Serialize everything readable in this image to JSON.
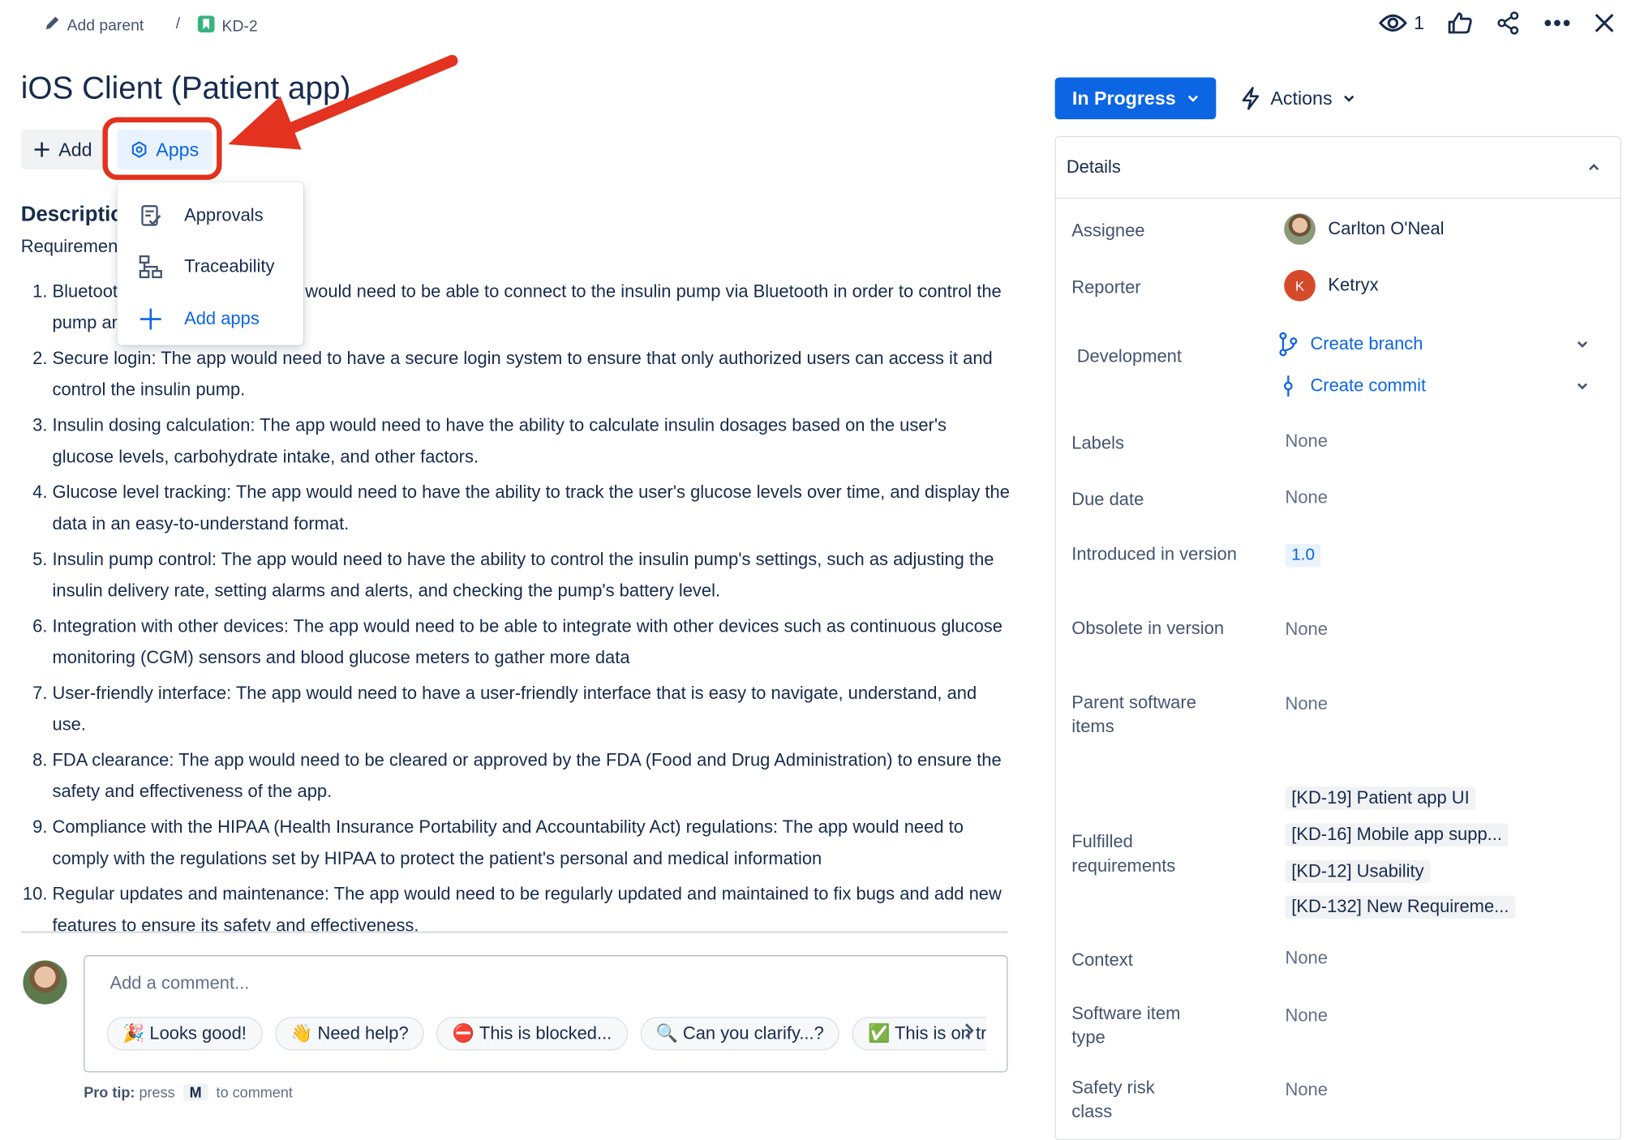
{
  "breadcrumb": {
    "add_parent": "Add parent",
    "separator": "/",
    "issue_key": "KD-2"
  },
  "top_actions": {
    "watch_count": "1"
  },
  "issue": {
    "title": "iOS Client (Patient app)"
  },
  "toolbar": {
    "add_label": "Add",
    "apps_label": "Apps"
  },
  "apps_menu": {
    "items": [
      {
        "label": "Approvals"
      },
      {
        "label": "Traceability"
      },
      {
        "label": "Add apps"
      }
    ]
  },
  "description": {
    "heading": "Description",
    "intro": "Requirements",
    "items": [
      "Bluetooth connectivity: The app would need to be able to connect to the insulin pump via Bluetooth in order to control the pump and retrieve data from it.",
      "Secure login: The app would need to have a secure login system to ensure that only authorized users can access it and control the insulin pump.",
      "Insulin dosing calculation: The app would need to have the ability to calculate insulin dosages based on the user's glucose levels, carbohydrate intake, and other factors.",
      "Glucose level tracking: The app would need to have the ability to track the user's glucose levels over time, and display the data in an easy-to-understand format.",
      "Insulin pump control: The app would need to have the ability to control the insulin pump's settings, such as adjusting the insulin delivery rate, setting alarms and alerts, and checking the pump's battery level.",
      "Integration with other devices: The app would need to be able to integrate with other devices such as continuous glucose monitoring (CGM) sensors and blood glucose meters to gather more data",
      "User-friendly interface: The app would need to have a user-friendly interface that is easy to navigate, understand, and use.",
      "FDA clearance: The app would need to be cleared or approved by the FDA (Food and Drug Administration) to ensure the safety and effectiveness of the app.",
      "Compliance with the HIPAA (Health Insurance Portability and Accountability Act) regulations: The app would need to comply with the regulations set by HIPAA to protect the patient's personal and medical information",
      "Regular updates and maintenance: The app would need to be regularly updated and maintained to fix bugs and add new features to ensure its safety and effectiveness."
    ]
  },
  "comment": {
    "placeholder": "Add a comment...",
    "chips": [
      "🎉 Looks good!",
      "👋 Need help?",
      "⛔ This is blocked...",
      "🔍 Can you clarify...?",
      "✅ This is on track"
    ],
    "pro_tip_label": "Pro tip:",
    "pro_tip_press": "press",
    "pro_tip_key": "M",
    "pro_tip_rest": "to comment"
  },
  "status": {
    "label": "In Progress",
    "actions_label": "Actions",
    "color": "#0c66e4"
  },
  "details": {
    "heading": "Details",
    "assignee": {
      "label": "Assignee",
      "value": "Carlton O'Neal"
    },
    "reporter": {
      "label": "Reporter",
      "value": "Ketryx",
      "initial": "K"
    },
    "development": {
      "label": "Development",
      "create_branch": "Create branch",
      "create_commit": "Create commit"
    },
    "labels": {
      "label": "Labels",
      "value": "None"
    },
    "due_date": {
      "label": "Due date",
      "value": "None"
    },
    "introduced_in_version": {
      "label": "Introduced in version",
      "value": "1.0"
    },
    "obsolete_in_version": {
      "label": "Obsolete in version",
      "value": "None"
    },
    "parent_software_items": {
      "label": "Parent software items",
      "value": "None"
    },
    "fulfilled_requirements": {
      "label": "Fulfilled requirements",
      "items": [
        "[KD-19] Patient app UI",
        "[KD-16] Mobile app supp...",
        "[KD-12] Usability",
        "[KD-132] New Requireme..."
      ]
    },
    "context": {
      "label": "Context",
      "value": "None"
    },
    "software_item_type": {
      "label": "Software item type",
      "value": "None"
    },
    "safety_risk_class": {
      "label": "Safety risk class",
      "value": "None"
    }
  },
  "annotation": {
    "color": "#e3321f"
  }
}
